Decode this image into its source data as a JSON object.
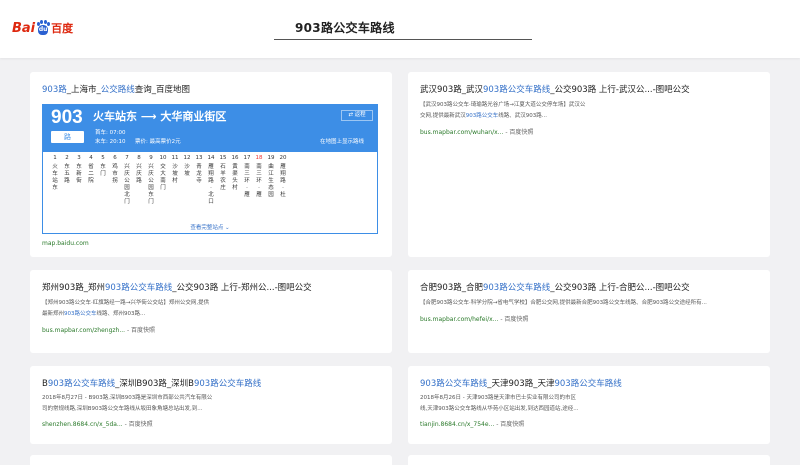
{
  "header": {
    "logo_bai": "Bai",
    "logo_paw_text": "du",
    "logo_du": "百度",
    "query": "903路公交车路线"
  },
  "results": [
    {
      "title_pre": "903路",
      "title_mid": "_上海市_",
      "title_hl": "公交路线",
      "title_post": "查询_百度地图",
      "widget": {
        "line_number": "903",
        "route_label": "路",
        "direction": "火车站东 ⟶ 大华商业街区",
        "first_bus": "首车: 07:00",
        "last_bus": "末车: 20:10",
        "fare": "票价: 最高票价2元",
        "reverse": "⇄ 返程",
        "map_link": "在地图上显示路线",
        "more": "查看完整站点 ⌄",
        "stops": [
          {
            "n": "1",
            "name": "火车站东"
          },
          {
            "n": "2",
            "name": "东五路"
          },
          {
            "n": "3",
            "name": "东新街"
          },
          {
            "n": "4",
            "name": "省二院"
          },
          {
            "n": "5",
            "name": "东门"
          },
          {
            "n": "6",
            "name": "鸡市拐"
          },
          {
            "n": "7",
            "name": "兴庆公园北门"
          },
          {
            "n": "8",
            "name": "兴庆路"
          },
          {
            "n": "9",
            "name": "兴庆公园东门"
          },
          {
            "n": "10",
            "name": "交大南门"
          },
          {
            "n": "11",
            "name": "沙坡村"
          },
          {
            "n": "12",
            "name": "沙坡"
          },
          {
            "n": "13",
            "name": "青龙寺"
          },
          {
            "n": "14",
            "name": "雁翔路·北口"
          },
          {
            "n": "15",
            "name": "石羊农庄"
          },
          {
            "n": "16",
            "name": "黄渠头村"
          },
          {
            "n": "17",
            "name": "南三环·雁"
          },
          {
            "n": "18",
            "name": "南三环·雁"
          },
          {
            "n": "19",
            "name": "曲江生态园"
          },
          {
            "n": "20",
            "name": "雁翔路·杜"
          }
        ]
      },
      "url": "map.baidu.com"
    },
    {
      "title_pre": "武汉903路_武汉",
      "title_hl": "903路公交车路线",
      "title_post": "_公交903路 上行-武汉公...-图吧公交",
      "snippet_l1": "【武汉903路公交车·琦瑜路光谷广场→江夏大道公交停车场】武汉公",
      "snippet_l2_pre": "交网,提供最新武汉",
      "snippet_l2_hl": "903路公交车",
      "snippet_l2_post": "线路、武汉903路...",
      "url": "bus.mapbar.com/wuhan/x...",
      "cache": "- 百度快照"
    },
    {
      "title_pre": "郑州903路_郑州",
      "title_hl": "903路公交车路线",
      "title_post": "_公交903路 上行-郑州公...-图吧公交",
      "snippet_l1": "【郑州903路公交车·红旗路经一路→兴华街公交站】郑州公交网,提供",
      "snippet_l2_pre": "最新郑州",
      "snippet_l2_hl": "903路公交车",
      "snippet_l2_post": "线路、郑州903路...",
      "url": "bus.mapbar.com/zhengzh...",
      "cache": "- 百度快照"
    },
    {
      "title_pre": "合肥903路_合肥",
      "title_hl": "903路公交车路线",
      "title_post": "_公交903路 上行-合肥公...-图吧公交",
      "snippet_l1": "【合肥903路公交车·科学分院→省电气学校】合肥公交网,提供最新合肥903路公交车线路、合肥903路公交途经所有...",
      "url": "bus.mapbar.com/hefei/x...",
      "cache": "- 百度快照"
    },
    {
      "title_pre": "B",
      "title_hl": "903路公交车路线",
      "title_post": "_深圳B903路_深圳B",
      "title_hl2": "903路公交车路线",
      "snippet_l1": "2018年8月27日 - B903路,深圳B903路是深圳市西部公共汽车有限公",
      "snippet_l2": "司的常规线路,深圳B903路公交车路线从坂田象角塘总站出发,到...",
      "url": "shenzhen.8684.cn/x_5da...",
      "cache": "- 百度快照"
    },
    {
      "title_pre": "",
      "title_hl": "903路公交车路线",
      "title_post": "_天津903路_天津",
      "title_hl2": "903路公交车路线",
      "snippet_l1": "2018年8月26日 - 天津903路是天津市巴士实业有限公司的市区",
      "snippet_l2": "线,天津903路公交车路线从华苑小区站出发,到达西园道站,途经...",
      "url": "tianjin.8684.cn/x_754e...",
      "cache": "- 百度快照"
    }
  ]
}
